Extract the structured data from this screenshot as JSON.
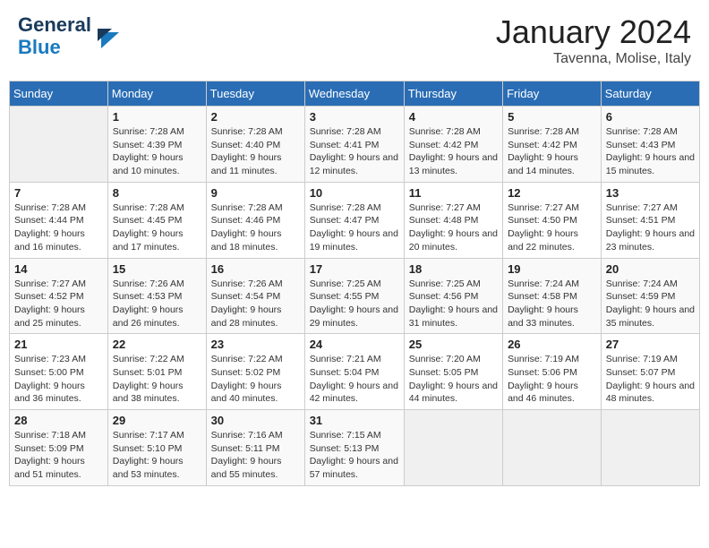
{
  "header": {
    "logo_line1": "General",
    "logo_line2": "Blue",
    "month_year": "January 2024",
    "location": "Tavenna, Molise, Italy"
  },
  "days_of_week": [
    "Sunday",
    "Monday",
    "Tuesday",
    "Wednesday",
    "Thursday",
    "Friday",
    "Saturday"
  ],
  "weeks": [
    [
      {
        "day": "",
        "sunrise": "",
        "sunset": "",
        "daylight": ""
      },
      {
        "day": "1",
        "sunrise": "Sunrise: 7:28 AM",
        "sunset": "Sunset: 4:39 PM",
        "daylight": "Daylight: 9 hours and 10 minutes."
      },
      {
        "day": "2",
        "sunrise": "Sunrise: 7:28 AM",
        "sunset": "Sunset: 4:40 PM",
        "daylight": "Daylight: 9 hours and 11 minutes."
      },
      {
        "day": "3",
        "sunrise": "Sunrise: 7:28 AM",
        "sunset": "Sunset: 4:41 PM",
        "daylight": "Daylight: 9 hours and 12 minutes."
      },
      {
        "day": "4",
        "sunrise": "Sunrise: 7:28 AM",
        "sunset": "Sunset: 4:42 PM",
        "daylight": "Daylight: 9 hours and 13 minutes."
      },
      {
        "day": "5",
        "sunrise": "Sunrise: 7:28 AM",
        "sunset": "Sunset: 4:42 PM",
        "daylight": "Daylight: 9 hours and 14 minutes."
      },
      {
        "day": "6",
        "sunrise": "Sunrise: 7:28 AM",
        "sunset": "Sunset: 4:43 PM",
        "daylight": "Daylight: 9 hours and 15 minutes."
      }
    ],
    [
      {
        "day": "7",
        "sunrise": "Sunrise: 7:28 AM",
        "sunset": "Sunset: 4:44 PM",
        "daylight": "Daylight: 9 hours and 16 minutes."
      },
      {
        "day": "8",
        "sunrise": "Sunrise: 7:28 AM",
        "sunset": "Sunset: 4:45 PM",
        "daylight": "Daylight: 9 hours and 17 minutes."
      },
      {
        "day": "9",
        "sunrise": "Sunrise: 7:28 AM",
        "sunset": "Sunset: 4:46 PM",
        "daylight": "Daylight: 9 hours and 18 minutes."
      },
      {
        "day": "10",
        "sunrise": "Sunrise: 7:28 AM",
        "sunset": "Sunset: 4:47 PM",
        "daylight": "Daylight: 9 hours and 19 minutes."
      },
      {
        "day": "11",
        "sunrise": "Sunrise: 7:27 AM",
        "sunset": "Sunset: 4:48 PM",
        "daylight": "Daylight: 9 hours and 20 minutes."
      },
      {
        "day": "12",
        "sunrise": "Sunrise: 7:27 AM",
        "sunset": "Sunset: 4:50 PM",
        "daylight": "Daylight: 9 hours and 22 minutes."
      },
      {
        "day": "13",
        "sunrise": "Sunrise: 7:27 AM",
        "sunset": "Sunset: 4:51 PM",
        "daylight": "Daylight: 9 hours and 23 minutes."
      }
    ],
    [
      {
        "day": "14",
        "sunrise": "Sunrise: 7:27 AM",
        "sunset": "Sunset: 4:52 PM",
        "daylight": "Daylight: 9 hours and 25 minutes."
      },
      {
        "day": "15",
        "sunrise": "Sunrise: 7:26 AM",
        "sunset": "Sunset: 4:53 PM",
        "daylight": "Daylight: 9 hours and 26 minutes."
      },
      {
        "day": "16",
        "sunrise": "Sunrise: 7:26 AM",
        "sunset": "Sunset: 4:54 PM",
        "daylight": "Daylight: 9 hours and 28 minutes."
      },
      {
        "day": "17",
        "sunrise": "Sunrise: 7:25 AM",
        "sunset": "Sunset: 4:55 PM",
        "daylight": "Daylight: 9 hours and 29 minutes."
      },
      {
        "day": "18",
        "sunrise": "Sunrise: 7:25 AM",
        "sunset": "Sunset: 4:56 PM",
        "daylight": "Daylight: 9 hours and 31 minutes."
      },
      {
        "day": "19",
        "sunrise": "Sunrise: 7:24 AM",
        "sunset": "Sunset: 4:58 PM",
        "daylight": "Daylight: 9 hours and 33 minutes."
      },
      {
        "day": "20",
        "sunrise": "Sunrise: 7:24 AM",
        "sunset": "Sunset: 4:59 PM",
        "daylight": "Daylight: 9 hours and 35 minutes."
      }
    ],
    [
      {
        "day": "21",
        "sunrise": "Sunrise: 7:23 AM",
        "sunset": "Sunset: 5:00 PM",
        "daylight": "Daylight: 9 hours and 36 minutes."
      },
      {
        "day": "22",
        "sunrise": "Sunrise: 7:22 AM",
        "sunset": "Sunset: 5:01 PM",
        "daylight": "Daylight: 9 hours and 38 minutes."
      },
      {
        "day": "23",
        "sunrise": "Sunrise: 7:22 AM",
        "sunset": "Sunset: 5:02 PM",
        "daylight": "Daylight: 9 hours and 40 minutes."
      },
      {
        "day": "24",
        "sunrise": "Sunrise: 7:21 AM",
        "sunset": "Sunset: 5:04 PM",
        "daylight": "Daylight: 9 hours and 42 minutes."
      },
      {
        "day": "25",
        "sunrise": "Sunrise: 7:20 AM",
        "sunset": "Sunset: 5:05 PM",
        "daylight": "Daylight: 9 hours and 44 minutes."
      },
      {
        "day": "26",
        "sunrise": "Sunrise: 7:19 AM",
        "sunset": "Sunset: 5:06 PM",
        "daylight": "Daylight: 9 hours and 46 minutes."
      },
      {
        "day": "27",
        "sunrise": "Sunrise: 7:19 AM",
        "sunset": "Sunset: 5:07 PM",
        "daylight": "Daylight: 9 hours and 48 minutes."
      }
    ],
    [
      {
        "day": "28",
        "sunrise": "Sunrise: 7:18 AM",
        "sunset": "Sunset: 5:09 PM",
        "daylight": "Daylight: 9 hours and 51 minutes."
      },
      {
        "day": "29",
        "sunrise": "Sunrise: 7:17 AM",
        "sunset": "Sunset: 5:10 PM",
        "daylight": "Daylight: 9 hours and 53 minutes."
      },
      {
        "day": "30",
        "sunrise": "Sunrise: 7:16 AM",
        "sunset": "Sunset: 5:11 PM",
        "daylight": "Daylight: 9 hours and 55 minutes."
      },
      {
        "day": "31",
        "sunrise": "Sunrise: 7:15 AM",
        "sunset": "Sunset: 5:13 PM",
        "daylight": "Daylight: 9 hours and 57 minutes."
      },
      {
        "day": "",
        "sunrise": "",
        "sunset": "",
        "daylight": ""
      },
      {
        "day": "",
        "sunrise": "",
        "sunset": "",
        "daylight": ""
      },
      {
        "day": "",
        "sunrise": "",
        "sunset": "",
        "daylight": ""
      }
    ]
  ]
}
